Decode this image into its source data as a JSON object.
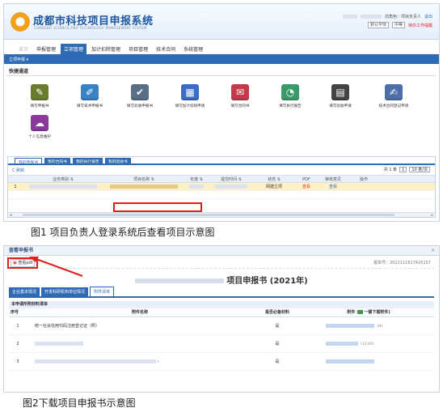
{
  "panel1": {
    "header": {
      "title": "成都市科技项目申报系统",
      "subtitle": "CHENGDU SCIENCE AND TECHNOLOGY MANAGEMENT SYSTEM",
      "role_text": "前角色：项目负责人",
      "logout": "退出",
      "pending_text": "待办工作提醒",
      "font_select": "中等",
      "normal_label": "默认字体"
    },
    "nav": {
      "tabs": [
        "首页",
        "申报管理",
        "立项管理",
        "加计扣除管理",
        "项目管理",
        "技术合同",
        "系统管理"
      ],
      "active_index": 2,
      "sub": "立项申报 ▾"
    },
    "quick": {
      "title": "快捷通道",
      "items": [
        {
          "label": "填写申报书",
          "icon": "pen-document-icon",
          "color": "#6a7d2f"
        },
        {
          "label": "填写技术申报书",
          "icon": "edit-form-icon",
          "color": "#3b82c4"
        },
        {
          "label": "填写验收申报书",
          "icon": "check-document-icon",
          "color": "#5a6e86"
        },
        {
          "label": "填写加计扣除申请",
          "icon": "calculator-icon",
          "color": "#3a6cc8"
        },
        {
          "label": "填写合同书",
          "icon": "contract-icon",
          "color": "#c43a4a"
        },
        {
          "label": "填写执行报告",
          "icon": "report-icon",
          "color": "#3a9a6a"
        },
        {
          "label": "填写验收申请",
          "icon": "notebook-icon",
          "color": "#444444"
        },
        {
          "label": "技术合同登记申请",
          "icon": "register-icon",
          "color": "#4c6fa8"
        },
        {
          "label": "个人信息维护",
          "icon": "profile-icon",
          "color": "#8a3a9a"
        }
      ]
    },
    "list": {
      "tabs": [
        "我的申报书",
        "我的合同书",
        "我的执行报告",
        "我的验收书"
      ],
      "active_index": 0,
      "refresh": "C 刷新",
      "pager": {
        "total": "共 1 条",
        "page": "1",
        "per_page": "10 条/页"
      },
      "columns": [
        "",
        "业务类别 ⇅",
        "项目名称 ⇅",
        "年度 ⇅",
        "提交时间 ⇅",
        "状态 ⇅",
        "PDF",
        "审核意见",
        "操作"
      ],
      "row": {
        "index": "1",
        "status": "网建立项",
        "pdf": "查看",
        "opinion": "查看"
      }
    },
    "caption": "图1 项目负责人登录系统后查看项目示意图"
  },
  "panel2": {
    "title": "查看申报书",
    "close": "×",
    "view_pdf": "查看pdf",
    "serial": "报单号：2022111617420157",
    "heading_suffix": "项目申报书 (2021年)",
    "tabs": [
      "企业基本情况",
      "开发科研机构单位情况",
      "附件清单"
    ],
    "active_tab": 2,
    "req_title": "本申请所附材料清单",
    "columns": {
      "no": "序号",
      "name": "附件名称",
      "required": "是否必备材料",
      "attach": "附件 (",
      "download_all": "一键下载附件",
      "attach_close": ")"
    },
    "rows": [
      {
        "no": "1",
        "name": "统一社会信用代码注册登记证（照）",
        "required": "是",
        "time": "34)"
      },
      {
        "no": "2",
        "name": "",
        "required": "是",
        "time": "(13:40)"
      },
      {
        "no": "3",
        "name": "",
        "required": "是",
        "time": ""
      }
    ],
    "caption": "图2下载项目申报书示意图"
  }
}
